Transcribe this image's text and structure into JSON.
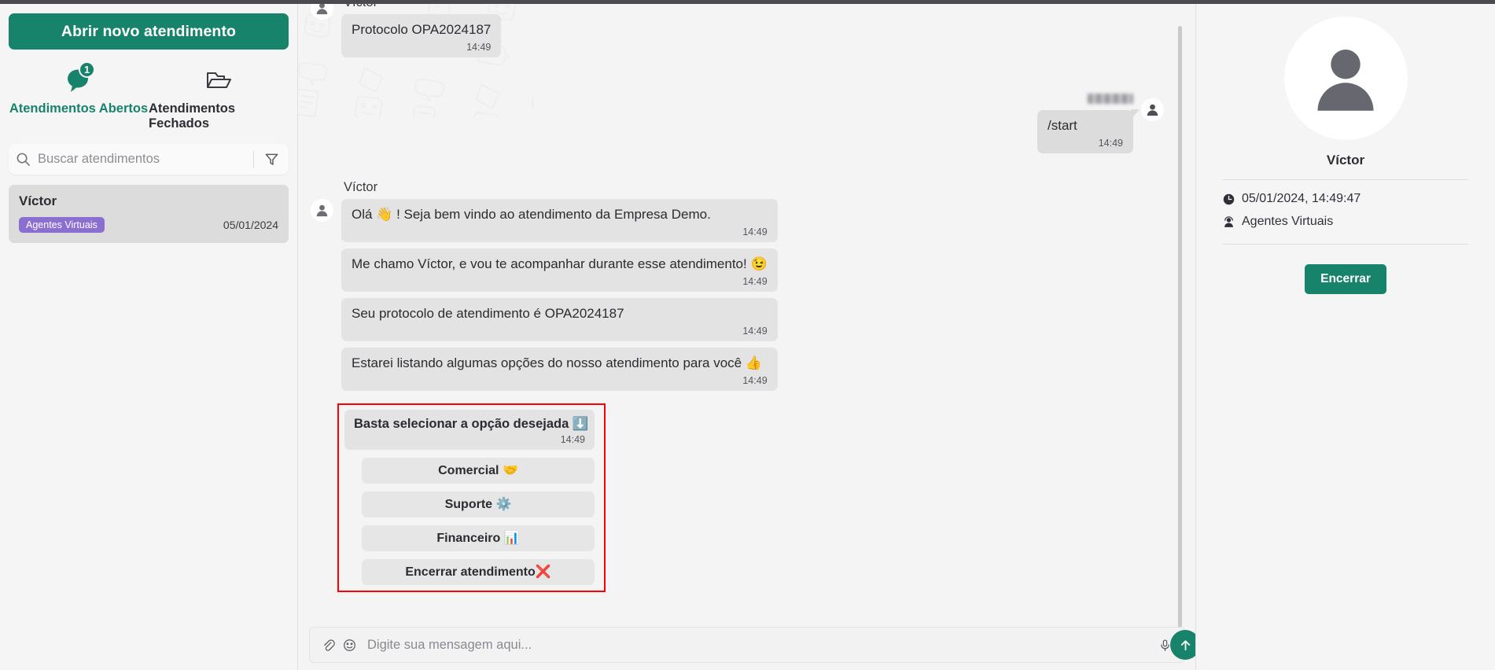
{
  "sidebar": {
    "new_conversation_label": "Abrir novo atendimento",
    "tabs": [
      {
        "label": "Atendimentos Abertos",
        "badge": "1",
        "icon": "chat-bubble-icon",
        "active": true
      },
      {
        "label": "Atendimentos Fechados",
        "badge": "",
        "icon": "open-folder-icon",
        "active": false
      }
    ],
    "search": {
      "placeholder": "Buscar atendimentos",
      "value": ""
    },
    "conversations": [
      {
        "name": "Víctor",
        "tag": "Agentes Virtuais",
        "date": "05/01/2024"
      }
    ]
  },
  "chat": {
    "messages": [
      {
        "sender": "Víctor",
        "text": "Protocolo OPA2024187",
        "time": "14:49",
        "side": "in",
        "show_sender": true
      },
      {
        "sender": "",
        "text": "/start",
        "time": "14:49",
        "side": "out",
        "show_sender": true
      },
      {
        "sender": "Víctor",
        "text": "Olá 👋 ! Seja bem vindo ao atendimento da Empresa Demo.",
        "time": "14:49",
        "side": "in",
        "show_sender": true
      },
      {
        "sender": "Víctor",
        "text": "Me chamo Víctor, e vou te acompanhar durante esse atendimento! 😉",
        "time": "14:49",
        "side": "in",
        "show_sender": false
      },
      {
        "sender": "Víctor",
        "text": "Seu protocolo de atendimento é OPA2024187",
        "time": "14:49",
        "side": "in",
        "show_sender": false
      },
      {
        "sender": "Víctor",
        "text": "Estarei listando algumas opções do nosso atendimento para você 👍",
        "time": "14:49",
        "side": "in",
        "show_sender": false
      }
    ],
    "menu": {
      "prompt": "Basta selecionar a opção desejada ⬇️",
      "time": "14:49",
      "options": [
        "Comercial 🤝",
        "Suporte ⚙️",
        "Financeiro 📊",
        "Encerrar atendimento❌"
      ]
    },
    "composer": {
      "placeholder": "Digite sua mensagem aqui...",
      "value": "",
      "attach_icon": "paperclip-icon",
      "emoji_icon": "emoji-icon",
      "mic_icon": "microphone-icon",
      "send_icon": "send-arrow-up-icon"
    }
  },
  "contact_panel": {
    "name": "Víctor",
    "datetime": "05/01/2024, 14:49:47",
    "queue": "Agentes Virtuais",
    "end_button_label": "Encerrar"
  },
  "colors": {
    "brand_green": "#18836b",
    "tag_purple": "#8b6fd0",
    "highlight_red": "#ff0000",
    "bubble_gray": "#e3e3e4"
  }
}
